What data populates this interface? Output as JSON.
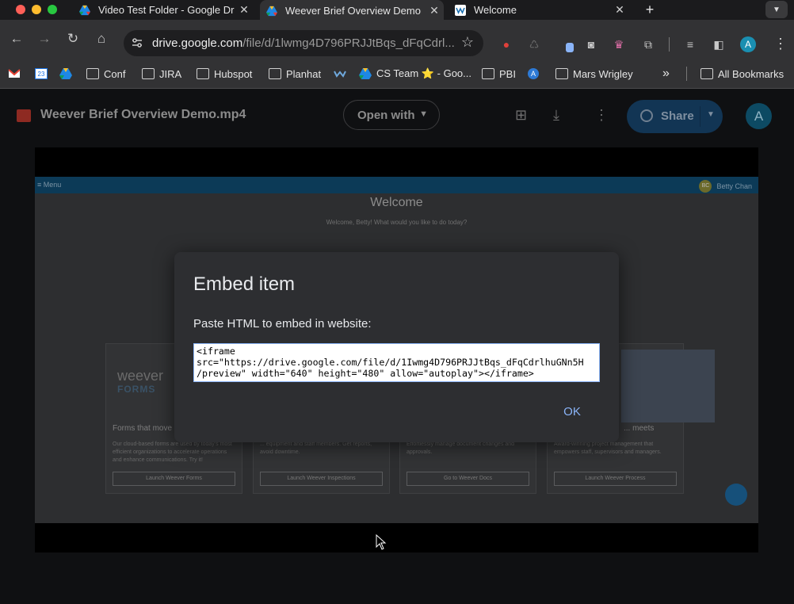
{
  "browser": {
    "tabs": [
      {
        "title": "Video Test Folder - Google Dr",
        "icon": "google-drive-icon"
      },
      {
        "title": "Weever Brief Overview Demo",
        "icon": "google-drive-icon"
      },
      {
        "title": "Welcome",
        "icon": "weever-icon"
      }
    ],
    "new_tab": "+",
    "url_host": "drive.google.com",
    "url_path": "/file/d/1lwmg4D796PRJJtBqs_dFqCdrl...",
    "profile_initial": "A"
  },
  "bookmarks": [
    {
      "label": "",
      "icon": "gmail-icon"
    },
    {
      "label": "",
      "icon": "calendar-icon",
      "badge": "23"
    },
    {
      "label": "",
      "icon": "google-drive-icon"
    },
    {
      "label": "Conf",
      "icon": "folder-icon"
    },
    {
      "label": "JIRA",
      "icon": "folder-icon"
    },
    {
      "label": "Hubspot",
      "icon": "folder-icon"
    },
    {
      "label": "Planhat",
      "icon": "folder-icon"
    },
    {
      "label": "",
      "icon": "weever-icon"
    },
    {
      "label": "CS Team ⭐ - Goo...",
      "icon": "google-drive-icon"
    },
    {
      "label": "PBI",
      "icon": "folder-icon"
    },
    {
      "label": "",
      "icon": "azure-icon"
    },
    {
      "label": "Mars Wrigley",
      "icon": "folder-icon"
    },
    {
      "label": "»",
      "icon": "overflow-icon"
    },
    {
      "label": "All Bookmarks",
      "icon": "folder-icon"
    }
  ],
  "viewer": {
    "file_name": "Weever Brief Overview Demo.mp4",
    "open_with": "Open with",
    "share": "Share",
    "user_initial": "A"
  },
  "video_frame": {
    "menu": "≡ Menu",
    "user_initials": "BC",
    "user_name": "Betty Chan",
    "welcome": "Welcome",
    "welcome_sub": "Welcome, Betty! What would you like to do today?",
    "logo_word": "weever",
    "logo_sub": "FORMS",
    "cards": [
      {
        "title": "Forms that move",
        "text": "Our cloud-based forms are used by today's most efficient organizations to accelerate operations and enhance communications. Try it!",
        "button": "Launch Weever Forms"
      },
      {
        "title": "",
        "text": "... equipment and staff members. Get reports, avoid downtime.",
        "button": "Launch Weever Inspections"
      },
      {
        "title": "",
        "text": "Effortlessly manage document changes and approvals.",
        "button": "Go to Weever Docs"
      },
      {
        "title": "... meets",
        "text": "Award-winning project management that empowers staff, supervisors and managers.",
        "button": "Launch Weever Process"
      }
    ]
  },
  "dialog": {
    "title": "Embed item",
    "label": "Paste HTML to embed in website:",
    "code": "<iframe\nsrc=\"https://drive.google.com/file/d/1Iwmg4D796PRJJtBqs_dFqCdrlhuGNn5H\n/preview\" width=\"640\" height=\"480\" allow=\"autoplay\"></iframe>",
    "ok": "OK"
  }
}
